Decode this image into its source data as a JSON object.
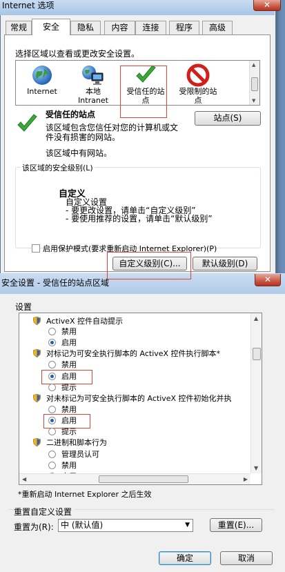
{
  "internet_options": {
    "title": "Internet 选项",
    "tabs": [
      "常规",
      "安全",
      "隐私",
      "内容",
      "连接",
      "程序",
      "高级"
    ],
    "active_tab": "安全",
    "zone_instructions": "选择区域以查看或更改安全设置。",
    "zones": [
      {
        "label": "Internet",
        "icon": "globe-icon"
      },
      {
        "label": "本地\nIntranet",
        "icon": "intranet-icon"
      },
      {
        "label": "受信任的站\n点",
        "icon": "checkmark-icon",
        "selected": true
      },
      {
        "label": "受限制的站\n点",
        "icon": "no-entry-icon"
      }
    ],
    "sites_button": "站点(S)",
    "zone_title": "受信任的站点",
    "zone_description": "该区域包含您信任对您的计算机或文件没有损害的网站。",
    "zone_has_sites": "该区域中有网站。",
    "security_level_label": "该区域的安全级别(L)",
    "custom_title": "自定义",
    "custom_lines": [
      "自定义设置",
      "- 要更改设置，请单击“自定义级别”",
      "- 要使用推荐的设置，请单击“默认级别”"
    ],
    "protected_mode_label": "启用保护模式(要求重新启动 Internet Explorer)(P)",
    "custom_level_button": "自定义级别(C)...",
    "default_level_button": "默认级别(D)",
    "close_glyph": "✕",
    "colors": {
      "check_green": "#3aa83a",
      "no_entry_red": "#d0201a",
      "highlight_red": "#e0403a"
    }
  },
  "security_settings": {
    "title": "安全设置 - 受信任的站点区域",
    "close_glyph": "✕",
    "settings_label": "设置",
    "rows": [
      {
        "type": "header",
        "text": "ActiveX 控件自动提示"
      },
      {
        "type": "option",
        "text": "禁用",
        "selected": false
      },
      {
        "type": "option",
        "text": "启用",
        "selected": true
      },
      {
        "type": "header",
        "text": "对标记为可安全执行脚本的 ActiveX 控件执行脚本*"
      },
      {
        "type": "option",
        "text": "禁用",
        "selected": false
      },
      {
        "type": "option",
        "text": "启用",
        "selected": true,
        "highlighted": true
      },
      {
        "type": "option",
        "text": "提示",
        "selected": false
      },
      {
        "type": "header",
        "text": "对未标记为可安全执行脚本的 ActiveX 控件初始化并执"
      },
      {
        "type": "option",
        "text": "禁用",
        "selected": false
      },
      {
        "type": "option",
        "text": "启用",
        "selected": true,
        "highlighted": true
      },
      {
        "type": "option",
        "text": "提示",
        "selected": false
      },
      {
        "type": "header",
        "text": "二进制和脚本行为"
      },
      {
        "type": "option",
        "text": "管理员认可",
        "selected": false
      },
      {
        "type": "option",
        "text": "禁用",
        "selected": false
      },
      {
        "type": "option",
        "text": "启用",
        "selected": false
      }
    ],
    "restart_note": "*重新启动 Internet Explorer 之后生效",
    "reset_group_label": "重置自定义设置",
    "reset_to_label": "重置为(R):",
    "reset_select_value": "中  (默认值)",
    "reset_button": "重置(E)...",
    "ok_button": "确定",
    "cancel_button": "取消"
  }
}
